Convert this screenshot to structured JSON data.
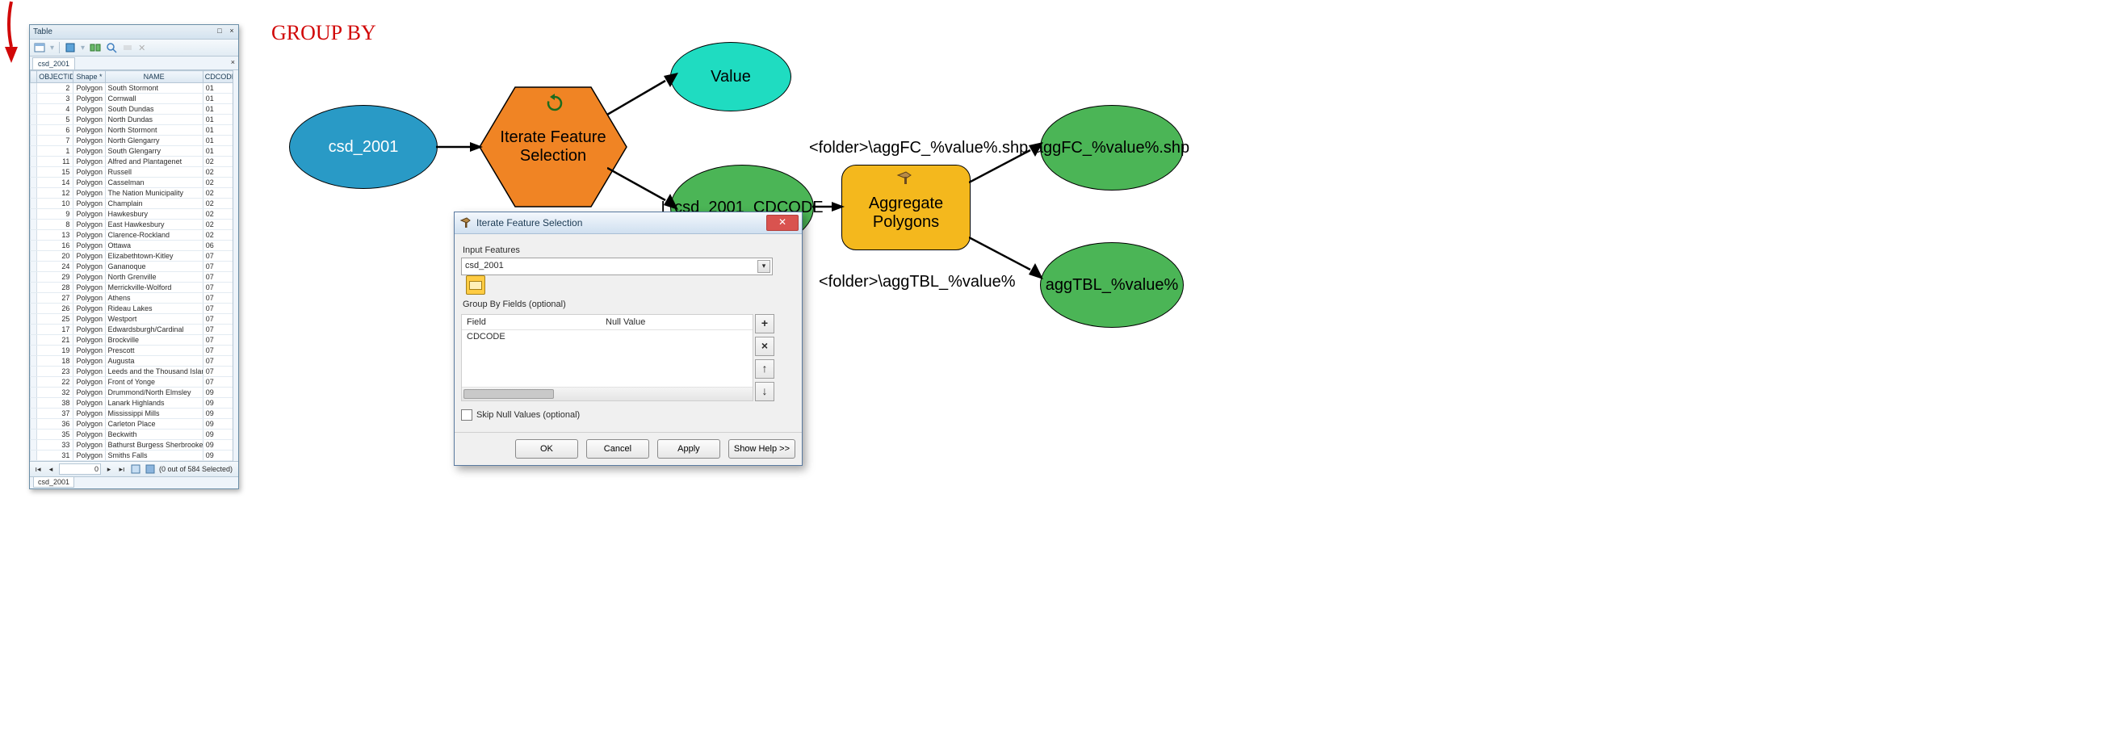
{
  "annotation": {
    "label": "GROUP BY"
  },
  "tableWindow": {
    "title": "Table",
    "tabName": "csd_2001",
    "columns": [
      "",
      "OBJECTID *",
      "Shape *",
      "NAME",
      "CDCODE"
    ],
    "rows": [
      {
        "oid": "2",
        "shape": "Polygon",
        "name": "South Stormont",
        "cd": "01"
      },
      {
        "oid": "3",
        "shape": "Polygon",
        "name": "Cornwall",
        "cd": "01"
      },
      {
        "oid": "4",
        "shape": "Polygon",
        "name": "South Dundas",
        "cd": "01"
      },
      {
        "oid": "5",
        "shape": "Polygon",
        "name": "North Dundas",
        "cd": "01"
      },
      {
        "oid": "6",
        "shape": "Polygon",
        "name": "North Stormont",
        "cd": "01"
      },
      {
        "oid": "7",
        "shape": "Polygon",
        "name": "North Glengarry",
        "cd": "01"
      },
      {
        "oid": "1",
        "shape": "Polygon",
        "name": "South Glengarry",
        "cd": "01"
      },
      {
        "oid": "11",
        "shape": "Polygon",
        "name": "Alfred and Plantagenet",
        "cd": "02"
      },
      {
        "oid": "15",
        "shape": "Polygon",
        "name": "Russell",
        "cd": "02"
      },
      {
        "oid": "14",
        "shape": "Polygon",
        "name": "Casselman",
        "cd": "02"
      },
      {
        "oid": "12",
        "shape": "Polygon",
        "name": "The Nation Municipality",
        "cd": "02"
      },
      {
        "oid": "10",
        "shape": "Polygon",
        "name": "Champlain",
        "cd": "02"
      },
      {
        "oid": "9",
        "shape": "Polygon",
        "name": "Hawkesbury",
        "cd": "02"
      },
      {
        "oid": "8",
        "shape": "Polygon",
        "name": "East Hawkesbury",
        "cd": "02"
      },
      {
        "oid": "13",
        "shape": "Polygon",
        "name": "Clarence-Rockland",
        "cd": "02"
      },
      {
        "oid": "16",
        "shape": "Polygon",
        "name": "Ottawa",
        "cd": "06"
      },
      {
        "oid": "20",
        "shape": "Polygon",
        "name": "Elizabethtown-Kitley",
        "cd": "07"
      },
      {
        "oid": "24",
        "shape": "Polygon",
        "name": "Gananoque",
        "cd": "07"
      },
      {
        "oid": "29",
        "shape": "Polygon",
        "name": "North Grenville",
        "cd": "07"
      },
      {
        "oid": "28",
        "shape": "Polygon",
        "name": "Merrickville-Wolford",
        "cd": "07"
      },
      {
        "oid": "27",
        "shape": "Polygon",
        "name": "Athens",
        "cd": "07"
      },
      {
        "oid": "26",
        "shape": "Polygon",
        "name": "Rideau Lakes",
        "cd": "07"
      },
      {
        "oid": "25",
        "shape": "Polygon",
        "name": "Westport",
        "cd": "07"
      },
      {
        "oid": "17",
        "shape": "Polygon",
        "name": "Edwardsburgh/Cardinal",
        "cd": "07"
      },
      {
        "oid": "21",
        "shape": "Polygon",
        "name": "Brockville",
        "cd": "07"
      },
      {
        "oid": "19",
        "shape": "Polygon",
        "name": "Prescott",
        "cd": "07"
      },
      {
        "oid": "18",
        "shape": "Polygon",
        "name": "Augusta",
        "cd": "07"
      },
      {
        "oid": "23",
        "shape": "Polygon",
        "name": "Leeds and the Thousand Islan",
        "cd": "07"
      },
      {
        "oid": "22",
        "shape": "Polygon",
        "name": "Front of Yonge",
        "cd": "07"
      },
      {
        "oid": "32",
        "shape": "Polygon",
        "name": "Drummond/North Elmsley",
        "cd": "09"
      },
      {
        "oid": "38",
        "shape": "Polygon",
        "name": "Lanark Highlands",
        "cd": "09"
      },
      {
        "oid": "37",
        "shape": "Polygon",
        "name": "Mississippi Mills",
        "cd": "09"
      },
      {
        "oid": "36",
        "shape": "Polygon",
        "name": "Carleton Place",
        "cd": "09"
      },
      {
        "oid": "35",
        "shape": "Polygon",
        "name": "Beckwith",
        "cd": "09"
      },
      {
        "oid": "33",
        "shape": "Polygon",
        "name": "Bathurst Burgess Sherbrooke",
        "cd": "09"
      },
      {
        "oid": "31",
        "shape": "Polygon",
        "name": "Smiths Falls",
        "cd": "09"
      }
    ],
    "nav": {
      "position": "0",
      "status": "(0 out of 584 Selected)"
    },
    "bottomTab": "csd_2001"
  },
  "model": {
    "input": "csd_2001",
    "iterator": "Iterate Feature Selection",
    "value": "Value",
    "selection": "I_csd_2001_CDCODE",
    "tool": "Aggregate Polygons",
    "out1": "aggFC_%value%.shp",
    "out2": "aggTBL_%value%",
    "lbl1": "<folder>\\aggFC_%value%.shp",
    "lbl2": "<folder>\\aggTBL_%value%"
  },
  "dialog": {
    "title": "Iterate Feature Selection",
    "labels": {
      "inputFeatures": "Input Features",
      "groupBy": "Group By Fields (optional)",
      "fieldCol": "Field",
      "nullCol": "Null Value",
      "skipNulls": "Skip Null Values (optional)"
    },
    "inputValue": "csd_2001",
    "groupByRows": [
      {
        "field": "CDCODE",
        "null": ""
      }
    ],
    "buttons": {
      "ok": "OK",
      "cancel": "Cancel",
      "apply": "Apply",
      "help": "Show Help >>"
    }
  }
}
